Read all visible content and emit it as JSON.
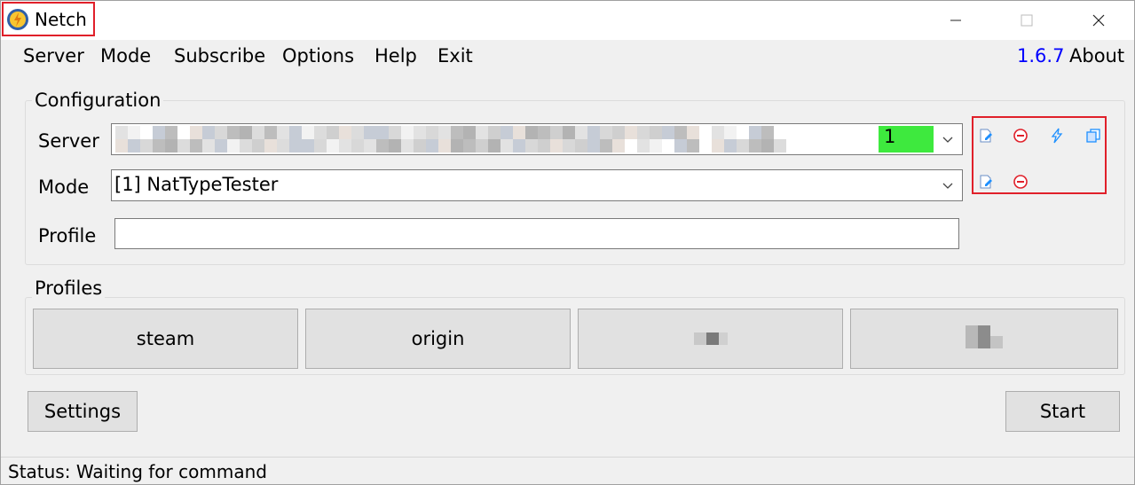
{
  "window": {
    "title": "Netch",
    "version": "1.6.7",
    "about_label": "About"
  },
  "menu": {
    "items": [
      "Server",
      "Mode",
      "Subscribe",
      "Options",
      "Help",
      "Exit"
    ]
  },
  "configuration": {
    "group_label": "Configuration",
    "server_label": "Server",
    "server_index": "1",
    "mode_label": "Mode",
    "mode_value": "[1] NatTypeTester",
    "profile_label": "Profile",
    "profile_value": ""
  },
  "toolbox": {
    "row1": [
      "edit-server-icon",
      "delete-server-icon",
      "speed-test-icon",
      "copy-server-icon"
    ],
    "row2": [
      "edit-mode-icon",
      "delete-mode-icon"
    ],
    "accent": "#1e90ff",
    "delete_color": "#e0202a"
  },
  "profiles": {
    "group_label": "Profiles",
    "buttons": [
      "steam",
      "origin",
      "",
      ""
    ]
  },
  "actions": {
    "settings_label": "Settings",
    "start_label": "Start"
  },
  "status": {
    "text": "Status: Waiting for command"
  },
  "colors": {
    "highlight_box": "#e0202a",
    "index_badge": "#3ee93e",
    "version_link": "#0000ff"
  }
}
